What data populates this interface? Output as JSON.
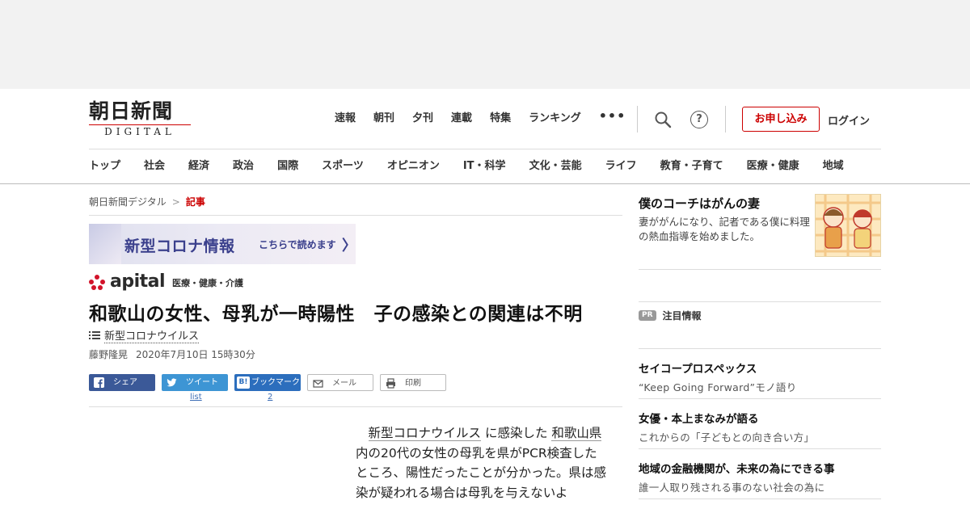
{
  "header": {
    "logo_kanji": "朝日新聞",
    "logo_sub": "DIGITAL",
    "topnav": [
      "速報",
      "朝刊",
      "夕刊",
      "連載",
      "特集",
      "ランキング"
    ],
    "more": "•••",
    "help": "?",
    "signup": "お申し込み",
    "login": "ログイン",
    "categories": [
      "トップ",
      "社会",
      "経済",
      "政治",
      "国際",
      "スポーツ",
      "オピニオン",
      "IT・科学",
      "文化・芸能",
      "ライフ",
      "教育・子育て",
      "医療・健康",
      "地域"
    ]
  },
  "breadcrumb": {
    "home": "朝日新聞デジタル",
    "sep": ">",
    "current": "記事"
  },
  "banner": {
    "title": "新型コロナ情報",
    "link": "こちらで読めます",
    "chevron": "〉"
  },
  "apital": {
    "word": "apital",
    "tag": "医療・健康・介護"
  },
  "article": {
    "headline": "和歌山の女性、母乳が一時陽性　子の感染との関連は不明",
    "topic": "新型コロナウイルス",
    "author": "藤野隆晃",
    "date": "2020年7月10日 15時30分",
    "share": {
      "facebook": "シェア",
      "twitter": "ツイート",
      "twitter_count": "list",
      "hatena": "ブックマーク",
      "hatena_icon": "B!",
      "hatena_count": "2",
      "mail": "メール",
      "print": "印刷"
    },
    "body_kw1": "新型コロナウイルス",
    "body_part1": "に感染した",
    "body_kw2": "和歌山県",
    "body_part2": "内の20代の女性の母乳を県がPCR検査したところ、陽性だったことが分かった。県は感染が疑われる場合は母乳を与えないよ"
  },
  "sidebar": {
    "promo_title": "僕のコーチはがんの妻",
    "promo_desc": "妻ががんになり、記者である僕に料理の熱血指導を始めました。",
    "pr_badge": "PR",
    "pr_label": "注目情報",
    "pr_items": [
      {
        "title": "セイコープロスペックス",
        "desc": "“Keep Going Forward”モノ語り"
      },
      {
        "title": "女優・本上まなみが語る",
        "desc": "これからの「子どもとの向き合い方」"
      },
      {
        "title": "地域の金融機関が、未来の為にできる事",
        "desc": "誰一人取り残される事のない社会の為に"
      }
    ]
  },
  "colors": {
    "accent_red": "#cc0000",
    "facebook": "#3b5998",
    "twitter": "#3d95d4",
    "hatena": "#2c6ebd",
    "corona_text": "#3a3f8c",
    "apital_red": "#d2132a"
  }
}
